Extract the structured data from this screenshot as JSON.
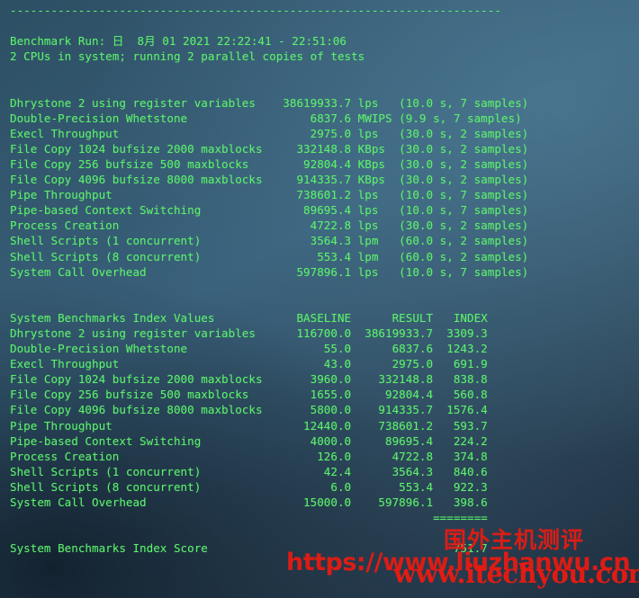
{
  "terminal": {
    "divider": "------------------------------------------------------------------------",
    "run_line": "Benchmark Run: 日  8月 01 2021 22:22:41 - 22:51:06",
    "cpu_line": "2 CPUs in system; running 2 parallel copies of tests",
    "results_section": [
      {
        "name": "Dhrystone 2 using register variables",
        "value": "38619933.7",
        "unit": "lps",
        "detail": "(10.0 s, 7 samples)"
      },
      {
        "name": "Double-Precision Whetstone",
        "value": "6837.6",
        "unit": "MWIPS",
        "detail": "(9.9 s, 7 samples)"
      },
      {
        "name": "Execl Throughput",
        "value": "2975.0",
        "unit": "lps",
        "detail": "(30.0 s, 2 samples)"
      },
      {
        "name": "File Copy 1024 bufsize 2000 maxblocks",
        "value": "332148.8",
        "unit": "KBps",
        "detail": "(30.0 s, 2 samples)"
      },
      {
        "name": "File Copy 256 bufsize 500 maxblocks",
        "value": "92804.4",
        "unit": "KBps",
        "detail": "(30.0 s, 2 samples)"
      },
      {
        "name": "File Copy 4096 bufsize 8000 maxblocks",
        "value": "914335.7",
        "unit": "KBps",
        "detail": "(30.0 s, 2 samples)"
      },
      {
        "name": "Pipe Throughput",
        "value": "738601.2",
        "unit": "lps",
        "detail": "(10.0 s, 7 samples)"
      },
      {
        "name": "Pipe-based Context Switching",
        "value": "89695.4",
        "unit": "lps",
        "detail": "(10.0 s, 7 samples)"
      },
      {
        "name": "Process Creation",
        "value": "4722.8",
        "unit": "lps",
        "detail": "(30.0 s, 2 samples)"
      },
      {
        "name": "Shell Scripts (1 concurrent)",
        "value": "3564.3",
        "unit": "lpm",
        "detail": "(60.0 s, 2 samples)"
      },
      {
        "name": "Shell Scripts (8 concurrent)",
        "value": "553.4",
        "unit": "lpm",
        "detail": "(60.0 s, 2 samples)"
      },
      {
        "name": "System Call Overhead",
        "value": "597896.1",
        "unit": "lps",
        "detail": "(10.0 s, 7 samples)"
      }
    ],
    "index_table": {
      "title": "System Benchmarks Index Values",
      "columns": [
        "BASELINE",
        "RESULT",
        "INDEX"
      ],
      "rows": [
        {
          "name": "Dhrystone 2 using register variables",
          "baseline": "116700.0",
          "result": "38619933.7",
          "index": "3309.3"
        },
        {
          "name": "Double-Precision Whetstone",
          "baseline": "55.0",
          "result": "6837.6",
          "index": "1243.2"
        },
        {
          "name": "Execl Throughput",
          "baseline": "43.0",
          "result": "2975.0",
          "index": "691.9"
        },
        {
          "name": "File Copy 1024 bufsize 2000 maxblocks",
          "baseline": "3960.0",
          "result": "332148.8",
          "index": "838.8"
        },
        {
          "name": "File Copy 256 bufsize 500 maxblocks",
          "baseline": "1655.0",
          "result": "92804.4",
          "index": "560.8"
        },
        {
          "name": "File Copy 4096 bufsize 8000 maxblocks",
          "baseline": "5800.0",
          "result": "914335.7",
          "index": "1576.4"
        },
        {
          "name": "Pipe Throughput",
          "baseline": "12440.0",
          "result": "738601.2",
          "index": "593.7"
        },
        {
          "name": "Pipe-based Context Switching",
          "baseline": "4000.0",
          "result": "89695.4",
          "index": "224.2"
        },
        {
          "name": "Process Creation",
          "baseline": "126.0",
          "result": "4722.8",
          "index": "374.8"
        },
        {
          "name": "Shell Scripts (1 concurrent)",
          "baseline": "42.4",
          "result": "3564.3",
          "index": "840.6"
        },
        {
          "name": "Shell Scripts (8 concurrent)",
          "baseline": "6.0",
          "result": "553.4",
          "index": "922.3"
        },
        {
          "name": "System Call Overhead",
          "baseline": "15000.0",
          "result": "597896.1",
          "index": "398.6"
        }
      ],
      "separator": "========",
      "score_label": "System Benchmarks Index Score",
      "score_value": "751.7"
    }
  },
  "watermark": {
    "brand_cn": "国外主机测评",
    "url_primary": "https://www.liuzhanwu.cn",
    "url_secondary": "www.itechyou.com",
    "color": "#e81b12"
  }
}
